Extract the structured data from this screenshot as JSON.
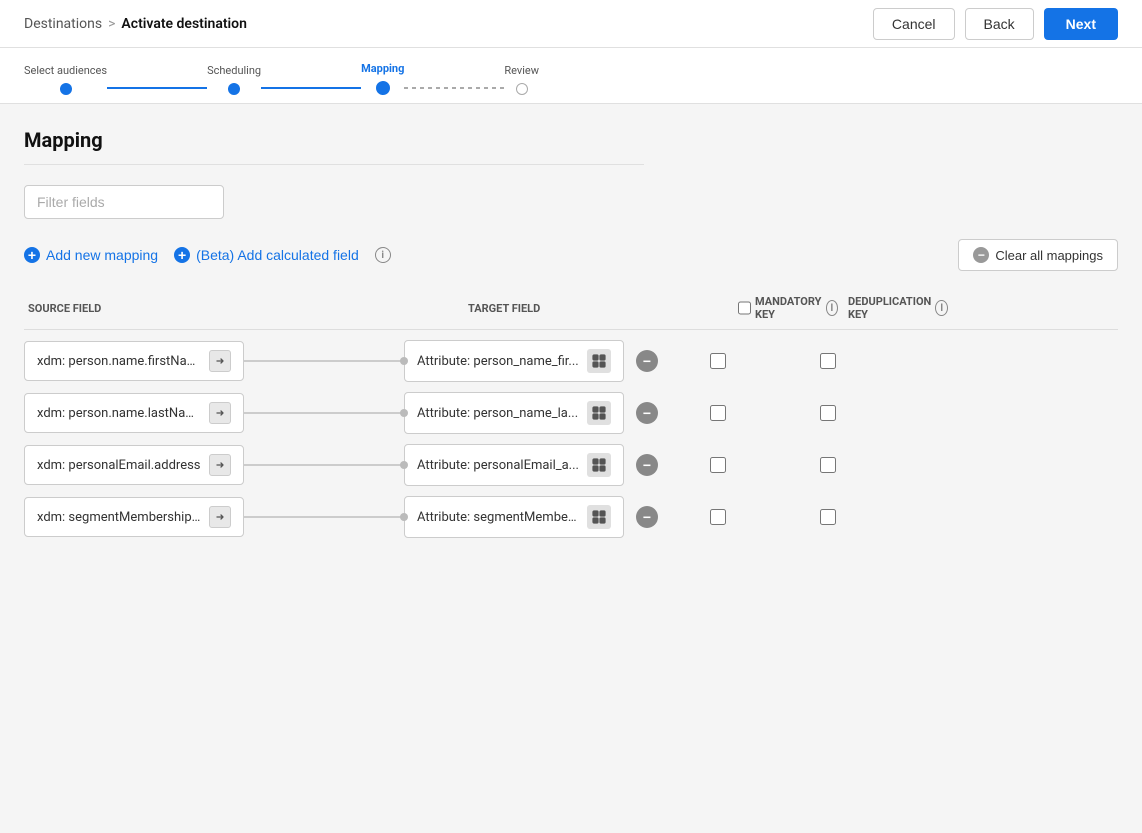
{
  "header": {
    "breadcrumb_root": "Destinations",
    "breadcrumb_separator": ">",
    "breadcrumb_current": "Activate destination",
    "cancel_label": "Cancel",
    "back_label": "Back",
    "next_label": "Next"
  },
  "progress": {
    "steps": [
      {
        "id": "select-audiences",
        "label": "Select audiences",
        "state": "completed"
      },
      {
        "id": "scheduling",
        "label": "Scheduling",
        "state": "completed"
      },
      {
        "id": "mapping",
        "label": "Mapping",
        "state": "active"
      },
      {
        "id": "review",
        "label": "Review",
        "state": "inactive"
      }
    ]
  },
  "main": {
    "title": "Mapping",
    "filter_placeholder": "Filter fields",
    "add_mapping_label": "Add new mapping",
    "add_calculated_label": "(Beta) Add calculated field",
    "clear_all_label": "Clear all mappings",
    "columns": {
      "source": "SOURCE FIELD",
      "target": "TARGET FIELD",
      "mandatory": "MANDATORY KEY",
      "dedup": "DEDUPLICATION KEY"
    },
    "mappings": [
      {
        "id": 1,
        "source": "xdm: person.name.firstName",
        "target": "Attribute: person_name_fir..."
      },
      {
        "id": 2,
        "source": "xdm: person.name.lastName",
        "target": "Attribute: person_name_la..."
      },
      {
        "id": 3,
        "source": "xdm: personalEmail.address",
        "target": "Attribute: personalEmail_a..."
      },
      {
        "id": 4,
        "source": "xdm: segmentMembership....",
        "target": "Attribute: segmentMember..."
      }
    ]
  }
}
